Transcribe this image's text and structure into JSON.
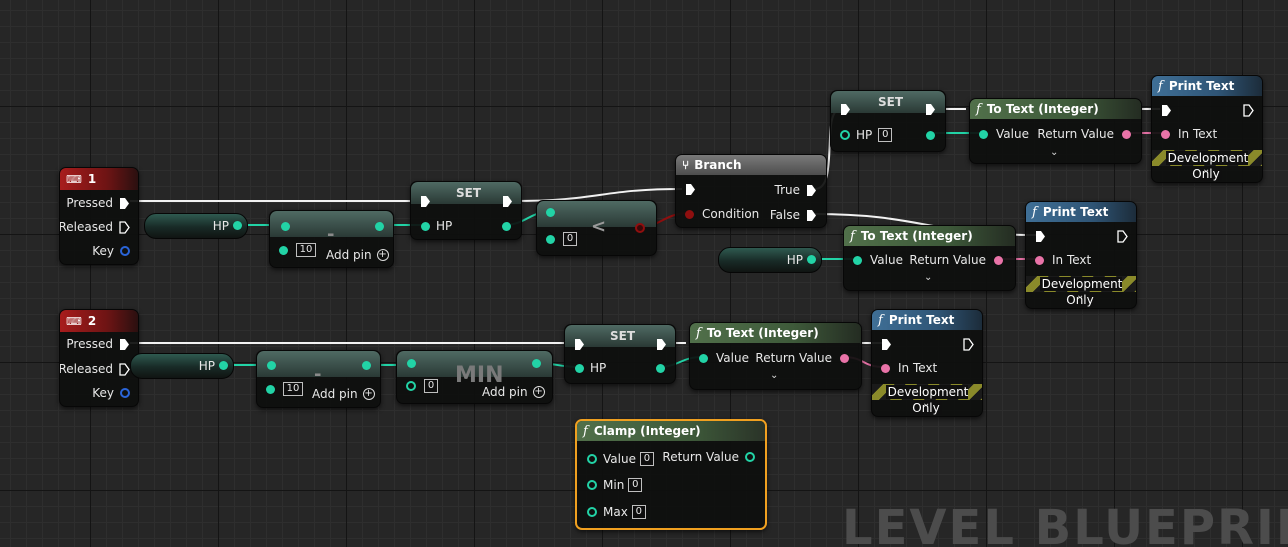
{
  "watermark": "LEVEL BLUEPRINT",
  "colors": {
    "int_pin": "#22d3a6",
    "text_pin": "#e973a8",
    "bool_pin": "#8f0f0f",
    "exec": "#ffffff",
    "selected": "#f0a020"
  },
  "events": [
    {
      "key": "1",
      "icon": "keyboard-icon",
      "pins": [
        "Pressed",
        "Released",
        "Key"
      ]
    },
    {
      "key": "2",
      "icon": "keyboard-icon",
      "pins": [
        "Pressed",
        "Released",
        "Key"
      ]
    }
  ],
  "variables": {
    "hp": "HP"
  },
  "subtract": {
    "op": "-",
    "value": "10",
    "add_pin": "Add pin"
  },
  "min_node": {
    "op": "MIN",
    "value": "0",
    "add_pin": "Add pin"
  },
  "set_node": {
    "title": "SET",
    "pin": "HP",
    "value": "0"
  },
  "less": {
    "op": "<",
    "value": "0"
  },
  "branch": {
    "title": "Branch",
    "condition": "Condition",
    "true": "True",
    "false": "False"
  },
  "to_text": {
    "title": "To Text (Integer)",
    "value": "Value",
    "return": "Return Value"
  },
  "print_text": {
    "title": "Print Text",
    "in_text": "In Text",
    "dev_only": "Development Only"
  },
  "clamp": {
    "title": "Clamp (Integer)",
    "value": "Value",
    "min": "Min",
    "max": "Max",
    "return": "Return Value",
    "value_val": "0",
    "min_val": "0",
    "max_val": "0"
  }
}
